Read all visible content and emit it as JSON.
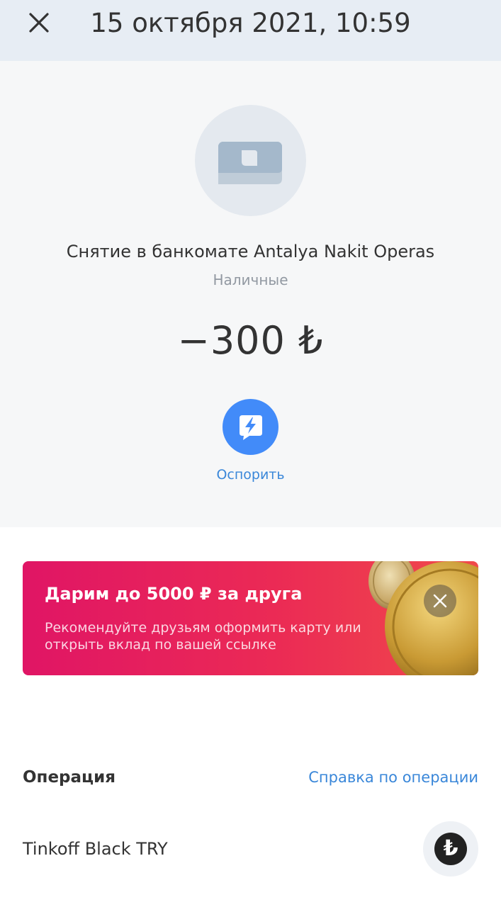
{
  "header": {
    "title": "15 октября 2021, 10:59"
  },
  "operation": {
    "name": "Снятие в банкомате Antalya Nakit Operas",
    "category": "Наличные",
    "amount": "−300 ₺",
    "icon": "cash-icon",
    "dispute_label": "Оспорить",
    "dispute_icon": "dispute-icon"
  },
  "promo": {
    "title": "Дарим до 5000 ₽ за друга",
    "text": "Рекомендуйте друзьям оформить карту или открыть вклад по вашей ссылке",
    "image": "coins-image"
  },
  "details": {
    "section_title": "Операция",
    "help_link": "Справка по операции",
    "account_name": "Tinkoff Black TRY",
    "account_currency_symbol": "₺"
  },
  "colors": {
    "header_bg": "#e7edf4",
    "section_bg": "#f6f7f8",
    "accent_blue": "#428bf9",
    "link_blue": "#3a87d9",
    "promo_start": "#e01565",
    "promo_end": "#f04a4a"
  }
}
